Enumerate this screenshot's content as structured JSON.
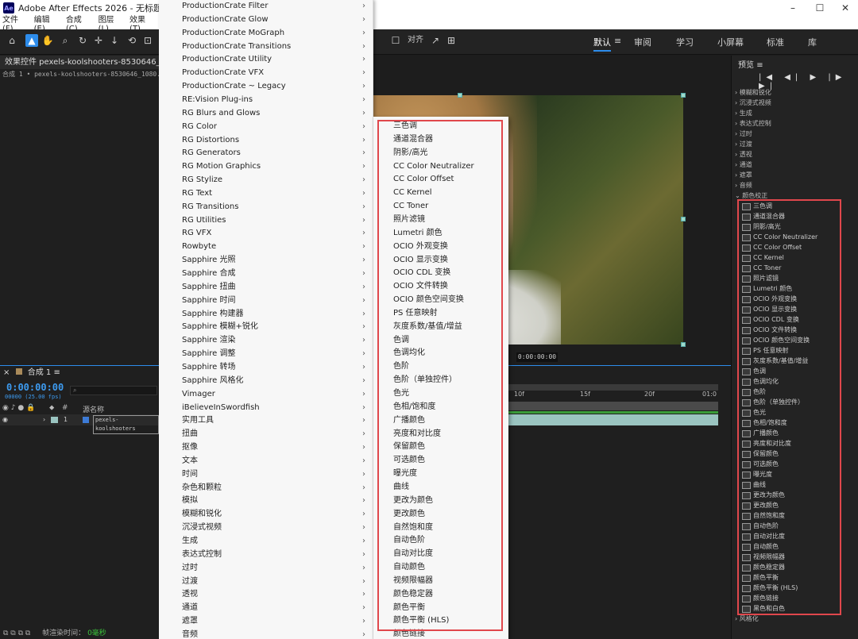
{
  "window": {
    "title": "Adobe After Effects 2026 - 无标题项目.aep *",
    "logo": "Ae",
    "minimize": "–",
    "maximize": "☐",
    "close": "✕"
  },
  "menubar": [
    "文件(F)",
    "编辑(E)",
    "合成(C)",
    "图层(L)",
    "效果(T)"
  ],
  "toolbar": {
    "snap_label": "对齐"
  },
  "workspaces": [
    "默认",
    "≡",
    "审阅",
    "学习",
    "小屏幕",
    "标准",
    "库"
  ],
  "left_panel": {
    "tab": "效果控件 pexels-koolshooters-8530646_",
    "subtitle": "合成 1 • pexels-koolshooters-8530646_1080.mp4"
  },
  "viewer": {
    "timecode": "0:00:00:00"
  },
  "timeline": {
    "tab": "合成 1",
    "time": "0:00:00:00",
    "fps": "00000 (25.00 fps)",
    "search_placeholder": "",
    "header": {
      "num": "#",
      "source": "源名称"
    },
    "layer": {
      "index": "1",
      "name": "pexels-koolshooters"
    },
    "ruler": [
      "10f",
      "15f",
      "20f",
      "01:0"
    ],
    "status_label": "帧渲染时间：",
    "status_value": "0毫秒"
  },
  "preview": {
    "title": "预览",
    "menu": "≡",
    "controls": "|◀ ◀| ▶ |▶ ▶|"
  },
  "right_categories": [
    "模糊和锐化",
    "沉浸式视频",
    "生成",
    "表达式控制",
    "过时",
    "过渡",
    "透视",
    "通道",
    "遮罩",
    "音频",
    "颜色校正"
  ],
  "right_effects": [
    "三色调",
    "通道混合器",
    "阴影/高光",
    "CC Color Neutralizer",
    "CC Color Offset",
    "CC Kernel",
    "CC Toner",
    "照片滤镜",
    "Lumetri 颜色",
    "OCIO 外观变换",
    "OCIO 显示变换",
    "OCIO CDL 变换",
    "OCIO 文件转换",
    "OCIO 颜色空间变换",
    "PS 任意映射",
    "灰度系数/基值/增益",
    "色调",
    "色调均化",
    "色阶",
    "色阶（单独控件）",
    "色光",
    "色相/饱和度",
    "广播颜色",
    "亮度和对比度",
    "保留颜色",
    "可选颜色",
    "曝光度",
    "曲线",
    "更改为颜色",
    "更改颜色",
    "自然饱和度",
    "自动色阶",
    "自动对比度",
    "自动颜色",
    "视频限幅器",
    "颜色稳定器",
    "颜色平衡",
    "颜色平衡 (HLS)",
    "颜色链接",
    "黑色和白色"
  ],
  "right_bottom": "风格化",
  "menu1": [
    "ProductionCrate Filter",
    "ProductionCrate Glow",
    "ProductionCrate MoGraph",
    "ProductionCrate Transitions",
    "ProductionCrate Utility",
    "ProductionCrate VFX",
    "ProductionCrate ~ Legacy",
    "RE:Vision Plug-ins",
    "RG Blurs and Glows",
    "RG Color",
    "RG Distortions",
    "RG Generators",
    "RG Motion Graphics",
    "RG Stylize",
    "RG Text",
    "RG Transitions",
    "RG Utilities",
    "RG VFX",
    "Rowbyte",
    "Sapphire 光照",
    "Sapphire 合成",
    "Sapphire 扭曲",
    "Sapphire 时间",
    "Sapphire 构建器",
    "Sapphire 模糊+锐化",
    "Sapphire 渲染",
    "Sapphire 调整",
    "Sapphire 转场",
    "Sapphire 风格化",
    "Vimager",
    "iBelieveInSwordfish",
    "实用工具",
    "扭曲",
    "抠像",
    "文本",
    "时间",
    "杂色和颗粒",
    "模拟",
    "模糊和锐化",
    "沉浸式视频",
    "生成",
    "表达式控制",
    "过时",
    "过渡",
    "透视",
    "通道",
    "遮罩",
    "音频"
  ],
  "menu2": [
    "三色调",
    "通道混合器",
    "阴影/高光",
    "CC Color Neutralizer",
    "CC Color Offset",
    "CC Kernel",
    "CC Toner",
    "照片滤镜",
    "Lumetri 颜色",
    "OCIO 外观变换",
    "OCIO 显示变换",
    "OCIO CDL 变换",
    "OCIO 文件转换",
    "OCIO 颜色空间变换",
    "PS 任意映射",
    "灰度系数/基值/增益",
    "色调",
    "色调均化",
    "色阶",
    "色阶（单独控件）",
    "色光",
    "色相/饱和度",
    "广播颜色",
    "亮度和对比度",
    "保留颜色",
    "可选颜色",
    "曝光度",
    "曲线",
    "更改为颜色",
    "更改颜色",
    "自然饱和度",
    "自动色阶",
    "自动对比度",
    "自动颜色",
    "视频限幅器",
    "颜色稳定器",
    "颜色平衡",
    "颜色平衡 (HLS)",
    "颜色链接"
  ],
  "arrow": "›"
}
